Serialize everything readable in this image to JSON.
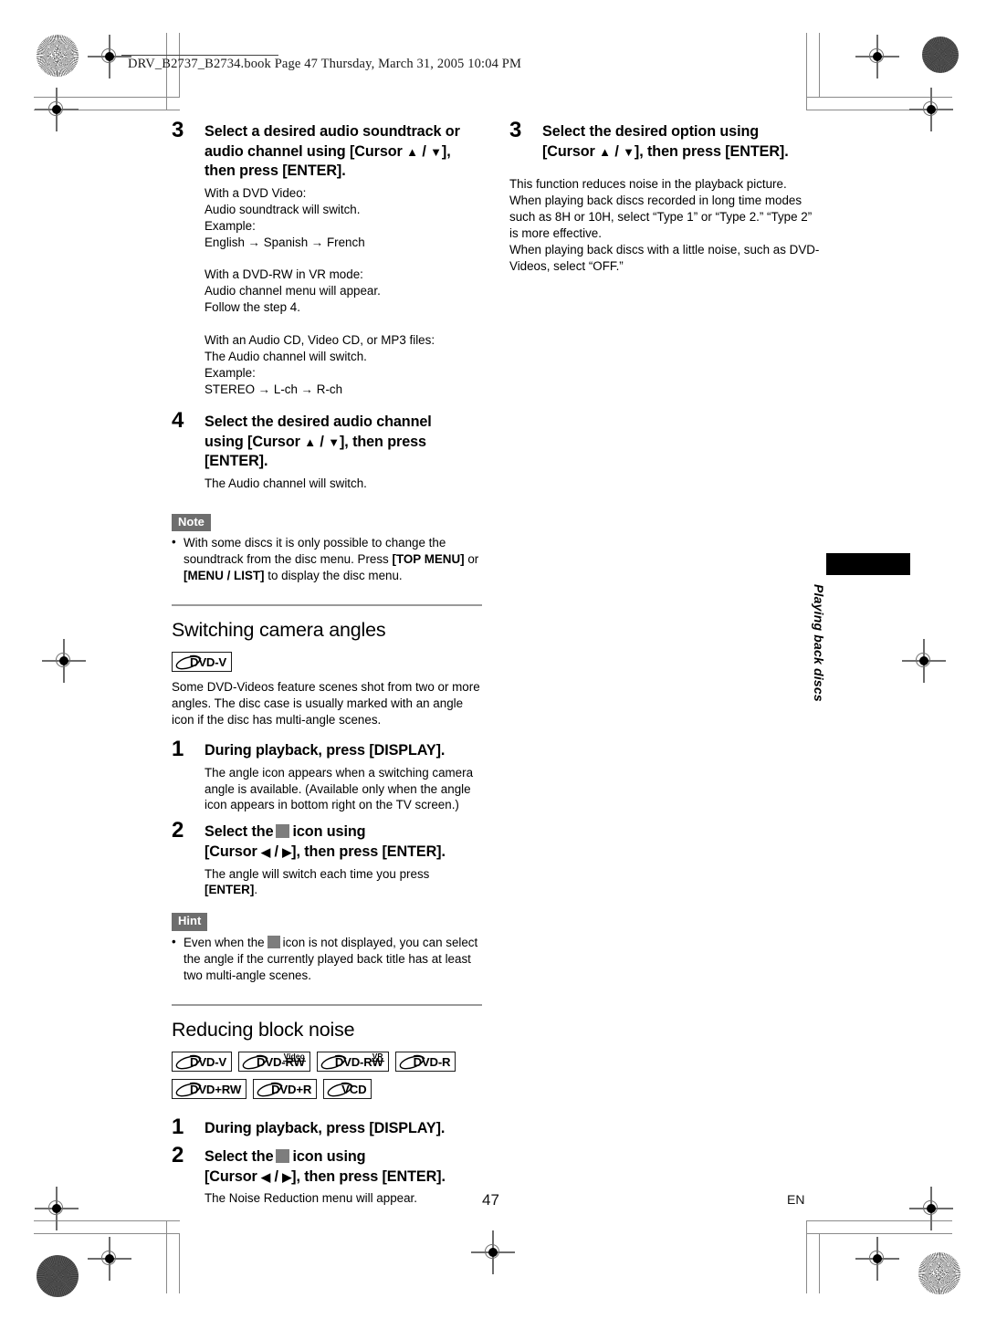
{
  "document": {
    "file_header": "DRV_B2737_B2734.book  Page 47  Thursday, March 31, 2005  10:04 PM",
    "page_number": "47",
    "language_code": "EN",
    "side_tab": "Playing back discs"
  },
  "left_column": {
    "step3": {
      "number": "3",
      "title_line1": "Select a desired audio soundtrack or",
      "title_line2_pre": "audio channel using [Cursor ",
      "title_line2_post": "],",
      "title_line3": "then press [ENTER].",
      "body_dvdvideo": [
        "With a DVD Video:",
        "Audio soundtrack will switch.",
        "Example:",
        "English → Spanish → French"
      ],
      "body_dvdrw": [
        "With a DVD-RW in VR mode:",
        "Audio channel menu will appear.",
        "Follow the step 4."
      ],
      "body_audiocd": [
        "With an Audio CD, Video CD, or MP3 files:",
        "The Audio channel will switch.",
        "Example:",
        "STEREO → L-ch → R-ch"
      ]
    },
    "step4": {
      "number": "4",
      "title_line1": "Select the desired audio channel",
      "title_line2_pre": "using [Cursor ",
      "title_line2_post": "], then press",
      "title_line3": "[ENTER].",
      "body": "The Audio channel will switch."
    },
    "note": {
      "label": "Note",
      "bullet": "•",
      "text_1": "With some discs it is only possible to change the soundtrack from the disc menu. Press ",
      "key_1": "[TOP MENU]",
      "text_2": " or ",
      "key_2": "[MENU / LIST]",
      "text_3": " to display the disc menu."
    },
    "camera_angles": {
      "heading": "Switching camera angles",
      "discs": [
        {
          "label": "DVD-V",
          "sup": ""
        }
      ],
      "intro": "Some DVD-Videos feature scenes shot from two or more angles. The disc case is usually marked with an angle icon if the disc has multi-angle scenes.",
      "step1": {
        "number": "1",
        "title": "During playback, press [DISPLAY].",
        "body": "The angle icon appears when a switching camera angle is available. (Available only when the angle icon appears in bottom right on the TV screen.)"
      },
      "step2": {
        "number": "2",
        "title_pre": "Select the",
        "title_mid": "icon using",
        "title_line2_pre": "[Cursor ",
        "title_line2_post": "], then press [ENTER].",
        "body_text": "The angle will switch each time you press ",
        "body_key": "[ENTER]",
        "body_tail": "."
      },
      "hint": {
        "label": "Hint",
        "bullet": "•",
        "text_pre": "Even when the",
        "text_post": "icon is not displayed, you can select the angle if the currently played back title has at least two multi-angle scenes."
      }
    },
    "block_noise": {
      "heading": "Reducing block noise",
      "discs_row1": [
        {
          "label": "DVD-V",
          "sup": ""
        },
        {
          "label": "DVD-RW",
          "sup": "Video"
        },
        {
          "label": "DVD-RW",
          "sup": "VR"
        },
        {
          "label": "DVD-R",
          "sup": ""
        }
      ],
      "discs_row2": [
        {
          "label": "DVD+RW",
          "sup": ""
        },
        {
          "label": "DVD+R",
          "sup": ""
        },
        {
          "label": "VCD",
          "sup": ""
        }
      ],
      "step1": {
        "number": "1",
        "title": "During playback, press [DISPLAY]."
      },
      "step2": {
        "number": "2",
        "title_pre": "Select the",
        "title_mid": "icon using",
        "title_line2_pre": "[Cursor ",
        "title_line2_post": "], then press [ENTER].",
        "body": "The Noise Reduction menu will appear."
      }
    }
  },
  "right_column": {
    "step3": {
      "number": "3",
      "title_line1": "Select the desired option using",
      "title_line2_pre": "[Cursor ",
      "title_line2_post": "], then press [ENTER]."
    },
    "paragraph": "This function reduces noise in the playback picture. When playing back discs recorded in long time modes such as 8H or 10H, select “Type 1” or “Type 2.” “Type 2” is more effective.",
    "paragraph2": "When playing back discs with a little noise, such as DVD-Videos, select “OFF.”"
  },
  "glyphs": {
    "cursor_up": "▲",
    "cursor_down": "▼",
    "cursor_left": "◀",
    "cursor_right": "▶",
    "slash": " / "
  },
  "colors": {
    "badge_gray": "#6e6e6e",
    "angle_icon_gray": "#7d7d7d",
    "rule_gray": "#9a9a9a",
    "side_tab_black": "#000000"
  }
}
